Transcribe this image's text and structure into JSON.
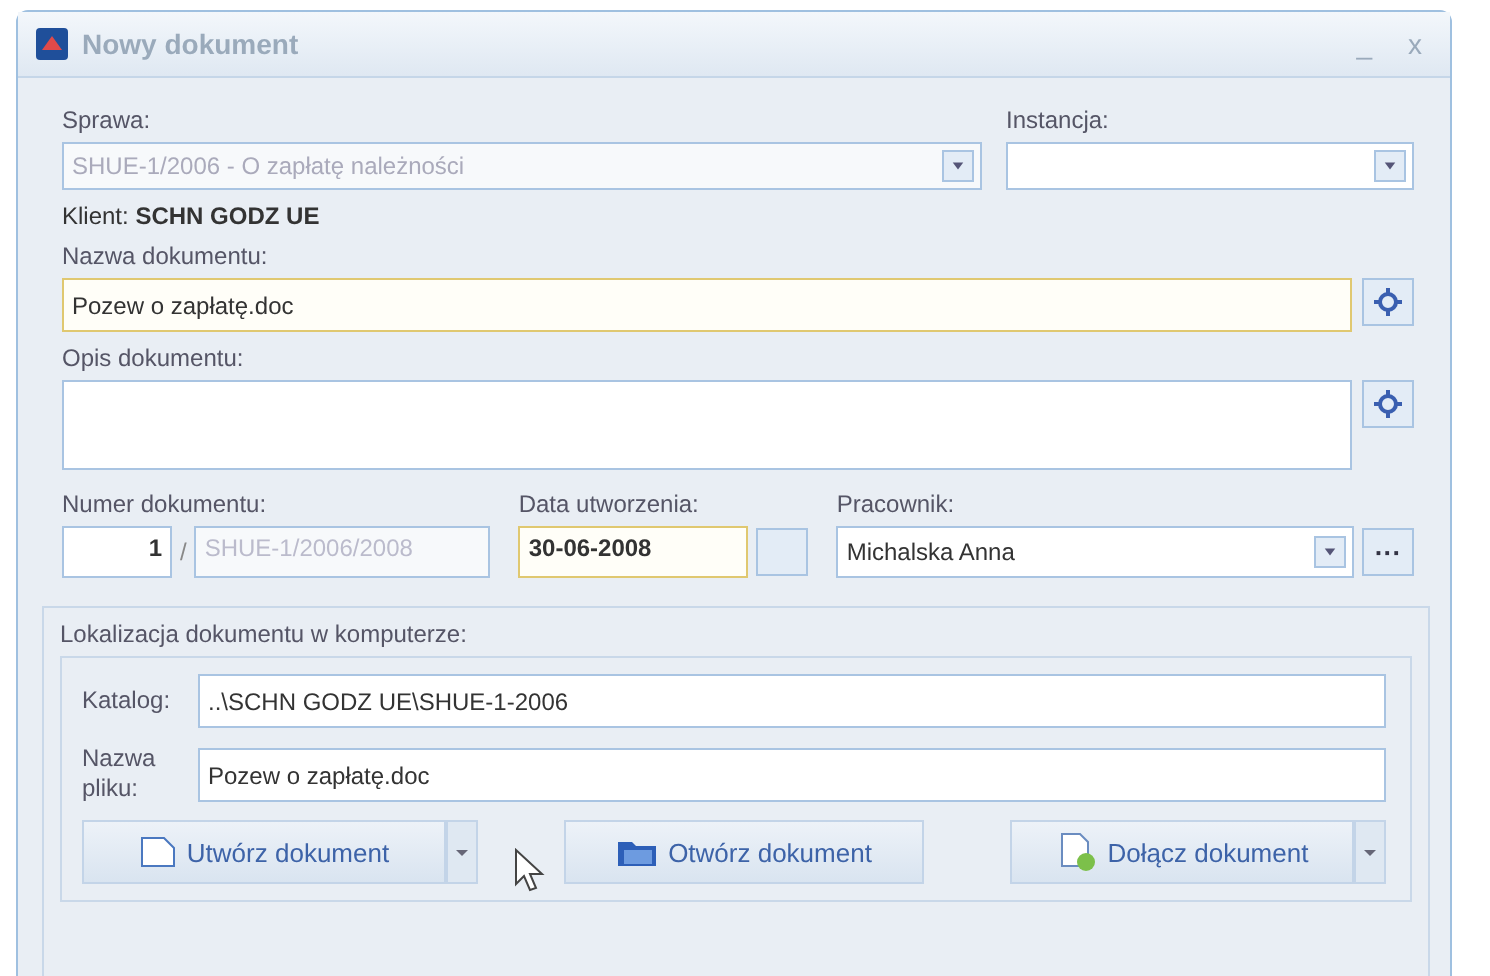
{
  "window": {
    "title": "Nowy dokument",
    "controls": [
      "_",
      "x"
    ]
  },
  "case": {
    "label": "Sprawa:",
    "value": "SHUE-1/2006 - O zapłatę należności",
    "disabled": true
  },
  "instance": {
    "label": "Instancja:"
  },
  "client": {
    "label": "Klient:",
    "value": "SCHN GODZ UE"
  },
  "doc_name": {
    "label": "Nazwa dokumentu:",
    "value": "Pozew o zapłatę.doc"
  },
  "doc_desc": {
    "label": "Opis dokumentu:"
  },
  "doc_number": {
    "label": "Numer dokumentu:",
    "number": "1",
    "separator": "/",
    "suffix": "SHUE-1/2006/2008"
  },
  "created": {
    "label": "Data utworzenia:",
    "value": "30-06-2008"
  },
  "employee": {
    "label": "Pracownik:",
    "value": "Michalska Anna",
    "more": "···"
  },
  "location": {
    "title": "Lokalizacja dokumentu w komputerze:",
    "fields": [
      {
        "label": "Katalog:",
        "value": "..\\SCHN GODZ UE\\SHUE-1-2006"
      },
      {
        "label": "Nazwa pliku:",
        "value": "Pozew o zapłatę.doc"
      }
    ],
    "buttons": [
      {
        "kind": "new",
        "label": "Utwórz dokument",
        "dropdown": true
      },
      {
        "kind": "open",
        "label": "Otwórz dokument",
        "dropdown": false
      },
      {
        "kind": "attach",
        "label": "Dołącz dokument",
        "dropdown": true
      }
    ]
  }
}
